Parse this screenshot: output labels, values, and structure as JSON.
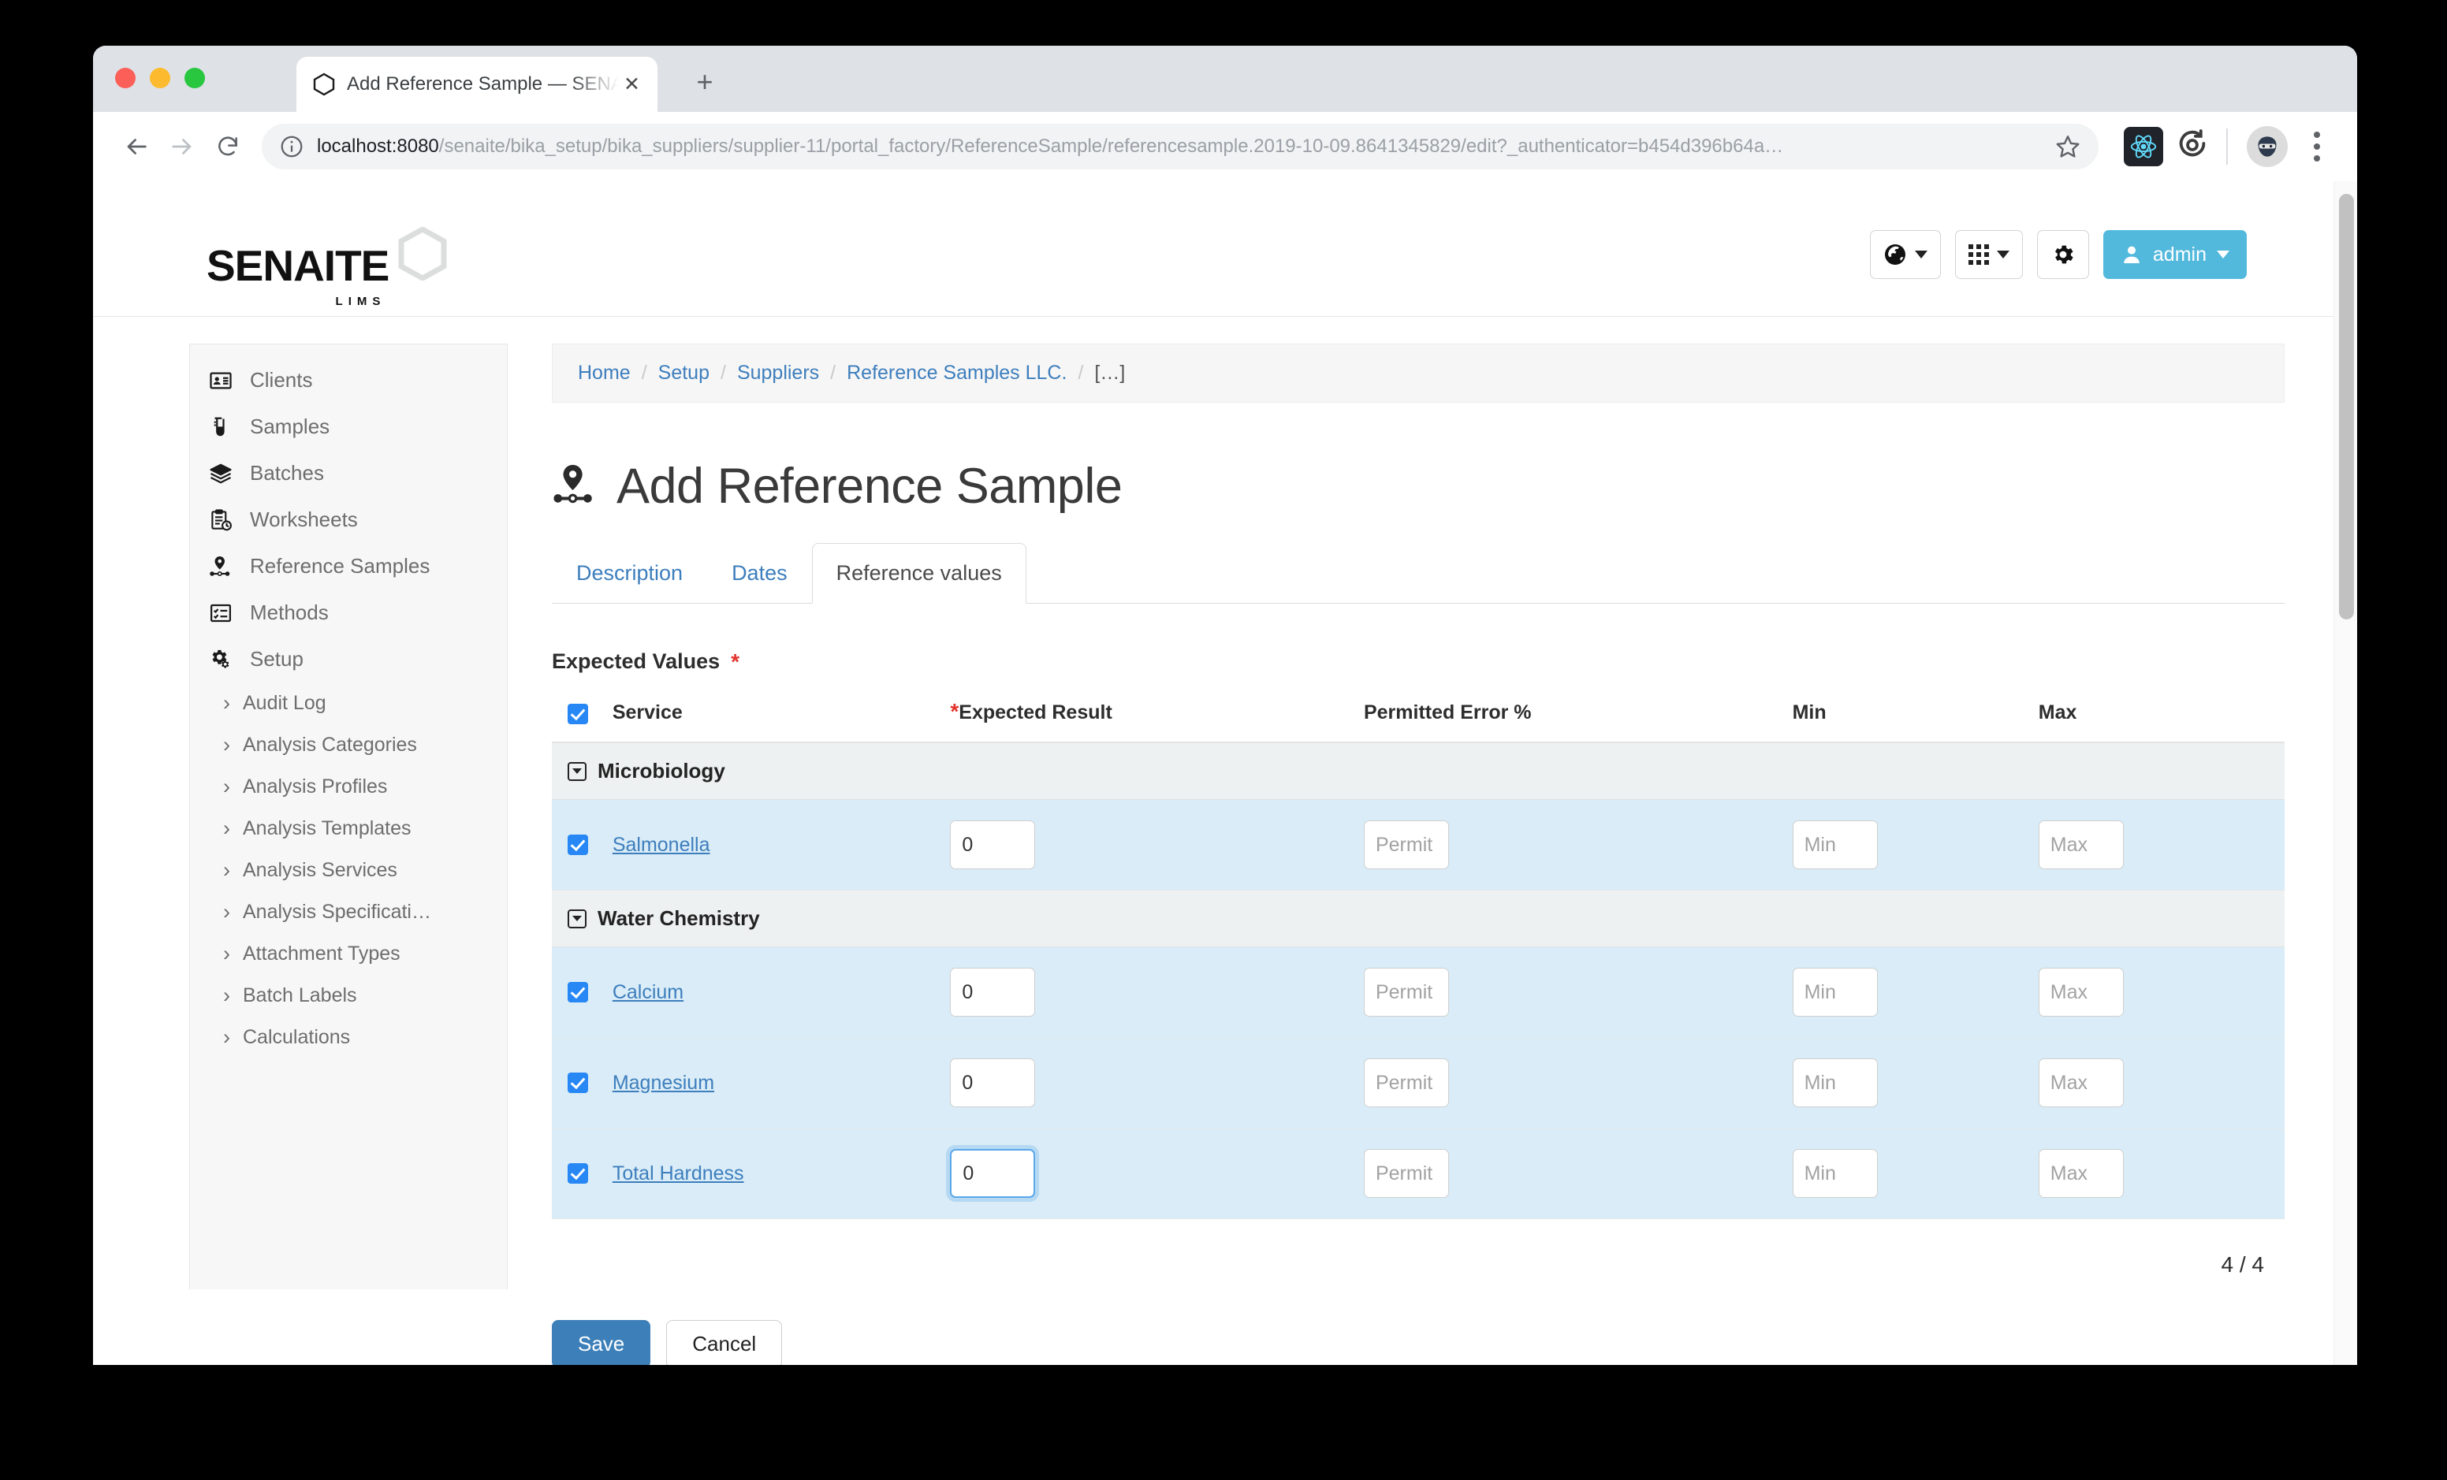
{
  "browser": {
    "tab_title": "Add Reference Sample — SENAITE",
    "tab_close_glyph": "✕",
    "new_tab_glyph": "+",
    "url_host": "localhost:8080",
    "url_path": "/senaite/bika_setup/bika_suppliers/supplier-11/portal_factory/ReferenceSample/referencesample.2019-10-09.8641345829/edit?_authenticator=b454d396b64a…",
    "back_label": "Back",
    "forward_label": "Forward",
    "reload_label": "Reload"
  },
  "header": {
    "logo_word": "SENAITE",
    "logo_sub": "LIMS",
    "language_label": "",
    "apps_label": "",
    "settings_label": "",
    "user_label": "admin"
  },
  "sidebar": {
    "items": [
      {
        "label": "Clients",
        "icon": "id-card-icon"
      },
      {
        "label": "Samples",
        "icon": "test-tube-icon"
      },
      {
        "label": "Batches",
        "icon": "layers-icon"
      },
      {
        "label": "Worksheets",
        "icon": "clipboard-clock-icon"
      },
      {
        "label": "Reference Samples",
        "icon": "map-pin-icon"
      },
      {
        "label": "Methods",
        "icon": "checklist-icon"
      },
      {
        "label": "Setup",
        "icon": "gears-icon"
      }
    ],
    "sub_items": [
      {
        "label": "Audit Log"
      },
      {
        "label": "Analysis Categories"
      },
      {
        "label": "Analysis Profiles"
      },
      {
        "label": "Analysis Templates"
      },
      {
        "label": "Analysis Services"
      },
      {
        "label": "Analysis Specificati…"
      },
      {
        "label": "Attachment Types"
      },
      {
        "label": "Batch Labels"
      },
      {
        "label": "Calculations"
      }
    ],
    "chevron_glyph": "›"
  },
  "breadcrumb": {
    "items": [
      {
        "label": "Home",
        "link": true
      },
      {
        "label": "Setup",
        "link": true
      },
      {
        "label": "Suppliers",
        "link": true
      },
      {
        "label": "Reference Samples LLC.",
        "link": true
      },
      {
        "label": "[…]",
        "link": false
      }
    ],
    "separator": "/"
  },
  "main": {
    "page_title": "Add Reference Sample",
    "page_title_icon": "map-pin-icon",
    "tabs": [
      {
        "label": "Description",
        "active": false
      },
      {
        "label": "Dates",
        "active": false
      },
      {
        "label": "Reference values",
        "active": true
      }
    ],
    "section_label": "Expected Values",
    "section_required_marker": "*",
    "table": {
      "headers": {
        "service": "Service",
        "expected_result": "Expected Result",
        "expected_result_required": "*",
        "permitted_error": "Permitted Error %",
        "min": "Min",
        "max": "Max"
      },
      "select_all_checked": true,
      "groups": [
        {
          "category": "Microbiology",
          "rows": [
            {
              "checked": true,
              "service": "Salmonella",
              "expected_result": "0",
              "permitted_error": "",
              "permitted_error_placeholder": "Permit",
              "min": "",
              "min_placeholder": "Min",
              "max": "",
              "max_placeholder": "Max",
              "focused": false
            }
          ]
        },
        {
          "category": "Water Chemistry",
          "rows": [
            {
              "checked": true,
              "service": "Calcium",
              "expected_result": "0",
              "permitted_error": "",
              "permitted_error_placeholder": "Permit",
              "min": "",
              "min_placeholder": "Min",
              "max": "",
              "max_placeholder": "Max",
              "focused": false
            },
            {
              "checked": true,
              "service": "Magnesium",
              "expected_result": "0",
              "permitted_error": "",
              "permitted_error_placeholder": "Permit",
              "min": "",
              "min_placeholder": "Min",
              "max": "",
              "max_placeholder": "Max",
              "focused": false
            },
            {
              "checked": true,
              "service": "Total Hardness",
              "expected_result": "0",
              "permitted_error": "",
              "permitted_error_placeholder": "Permit",
              "min": "",
              "min_placeholder": "Min",
              "max": "",
              "max_placeholder": "Max",
              "focused": true
            }
          ]
        }
      ]
    },
    "counter": "4 / 4",
    "save_label": "Save",
    "cancel_label": "Cancel"
  },
  "colors": {
    "accent_blue": "#3d7ebd",
    "admin_button": "#52b9dc",
    "row_highlight": "#d9ecf7",
    "category_bg": "#eef1f1",
    "required_red": "#e4332c",
    "checkbox_blue": "#2787f5"
  }
}
